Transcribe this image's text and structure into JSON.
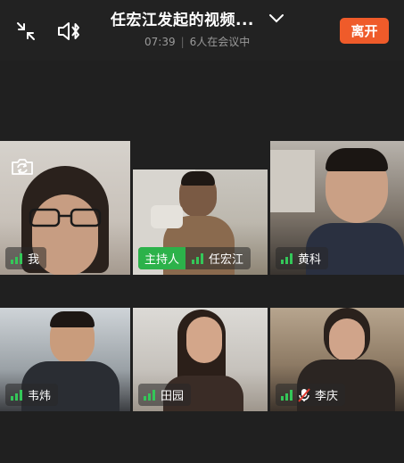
{
  "header": {
    "title": "任宏江发起的视频...",
    "time": "07:39",
    "participants": "6人在会议中",
    "leave_label": "离开"
  },
  "icons": {
    "collapse": "collapse-arrows-icon",
    "speaker": "speaker-bluetooth-icon",
    "dropdown": "chevron-down-icon",
    "camera_switch": "camera-switch-icon",
    "signal": "signal-bars-icon",
    "mic_muted": "mic-muted-icon"
  },
  "colors": {
    "accent_leave": "#ef5b2a",
    "host_badge": "#2cb24a",
    "signal_green": "#34c759",
    "background": "#202020"
  },
  "participants": [
    {
      "name": "我",
      "host": false,
      "muted": false
    },
    {
      "name": "任宏江",
      "host": true,
      "host_label": "主持人",
      "muted": false
    },
    {
      "name": "黄科",
      "host": false,
      "muted": false
    },
    {
      "name": "韦炜",
      "host": false,
      "muted": false
    },
    {
      "name": "田园",
      "host": false,
      "muted": false
    },
    {
      "name": "李庆",
      "host": false,
      "muted": true
    }
  ]
}
